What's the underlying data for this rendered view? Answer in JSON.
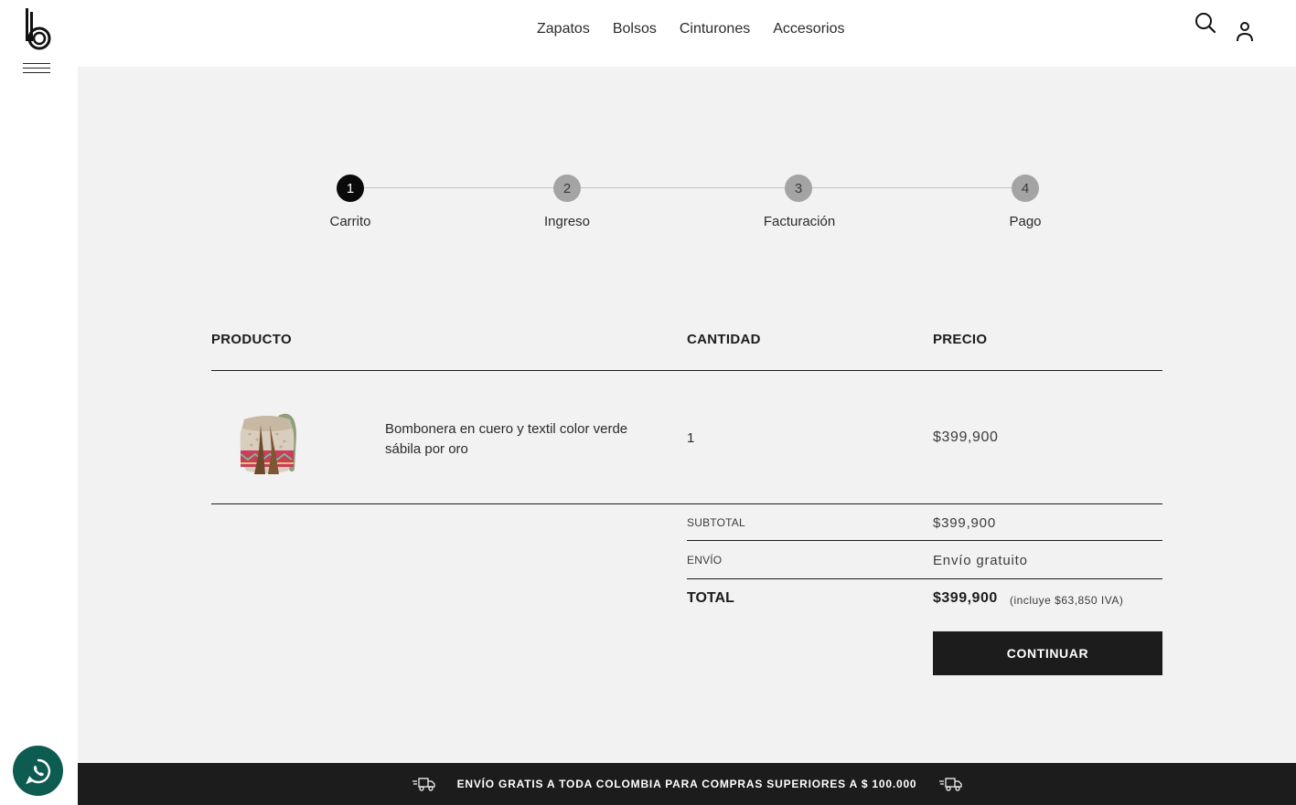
{
  "nav": {
    "items": [
      "Zapatos",
      "Bolsos",
      "Cinturones",
      "Accesorios"
    ]
  },
  "icons": {
    "logo": "brand-b-logo",
    "menu": "hamburger-icon",
    "search": "search-icon",
    "user": "user-icon",
    "whatsapp": "whatsapp-icon",
    "truck": "delivery-truck-icon"
  },
  "steps": [
    {
      "number": "1",
      "label": "Carrito",
      "active": true
    },
    {
      "number": "2",
      "label": "Ingreso",
      "active": false
    },
    {
      "number": "3",
      "label": "Facturación",
      "active": false
    },
    {
      "number": "4",
      "label": "Pago",
      "active": false
    }
  ],
  "table": {
    "headers": {
      "product": "PRODUCTO",
      "quantity": "CANTIDAD",
      "price": "PRECIO"
    },
    "rows": [
      {
        "name": "Bombonera en cuero y textil color verde sábila por oro",
        "quantity": "1",
        "price": "$399,900"
      }
    ]
  },
  "summary": {
    "subtotal_label": "SUBTOTAL",
    "subtotal_value": "$399,900",
    "shipping_label": "ENVÍO",
    "shipping_value": "Envío gratuito",
    "total_label": "TOTAL",
    "total_value": "$399,900",
    "total_note": "(incluye $63,850 IVA)"
  },
  "actions": {
    "continue_label": "CONTINUAR"
  },
  "banner": {
    "text": "ENVÍO GRATIS A TODA COLOMBIA PARA COMPRAS SUPERIORES A $ 100.000"
  },
  "colors": {
    "accent": "#1c1c1c",
    "whatsapp": "#0e5b52",
    "background": "#f2f2f2"
  }
}
